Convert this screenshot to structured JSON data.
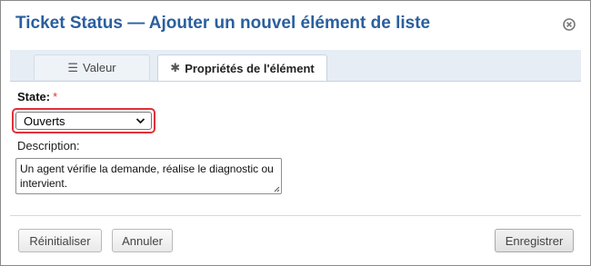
{
  "dialog": {
    "title": "Ticket Status — Ajouter un nouvel élément de liste",
    "close_icon": "close-circle-icon"
  },
  "tabs": [
    {
      "label": "Valeur",
      "icon": "menu-lines-icon",
      "active": false
    },
    {
      "label": "Propriétés de l'élément",
      "icon": "asterisk-icon",
      "active": true
    }
  ],
  "form": {
    "state_label": "State:",
    "required_marker": "*",
    "state_value": "Ouverts",
    "description_label": "Description:",
    "description_value": "Un agent vérifie la demande, réalise le diagnostic ou intervient."
  },
  "buttons": {
    "reset": "Réinitialiser",
    "cancel": "Annuler",
    "save": "Enregistrer"
  },
  "colors": {
    "title": "#2a5f9e",
    "error_border": "#e0313b",
    "required": "#dd3333"
  }
}
